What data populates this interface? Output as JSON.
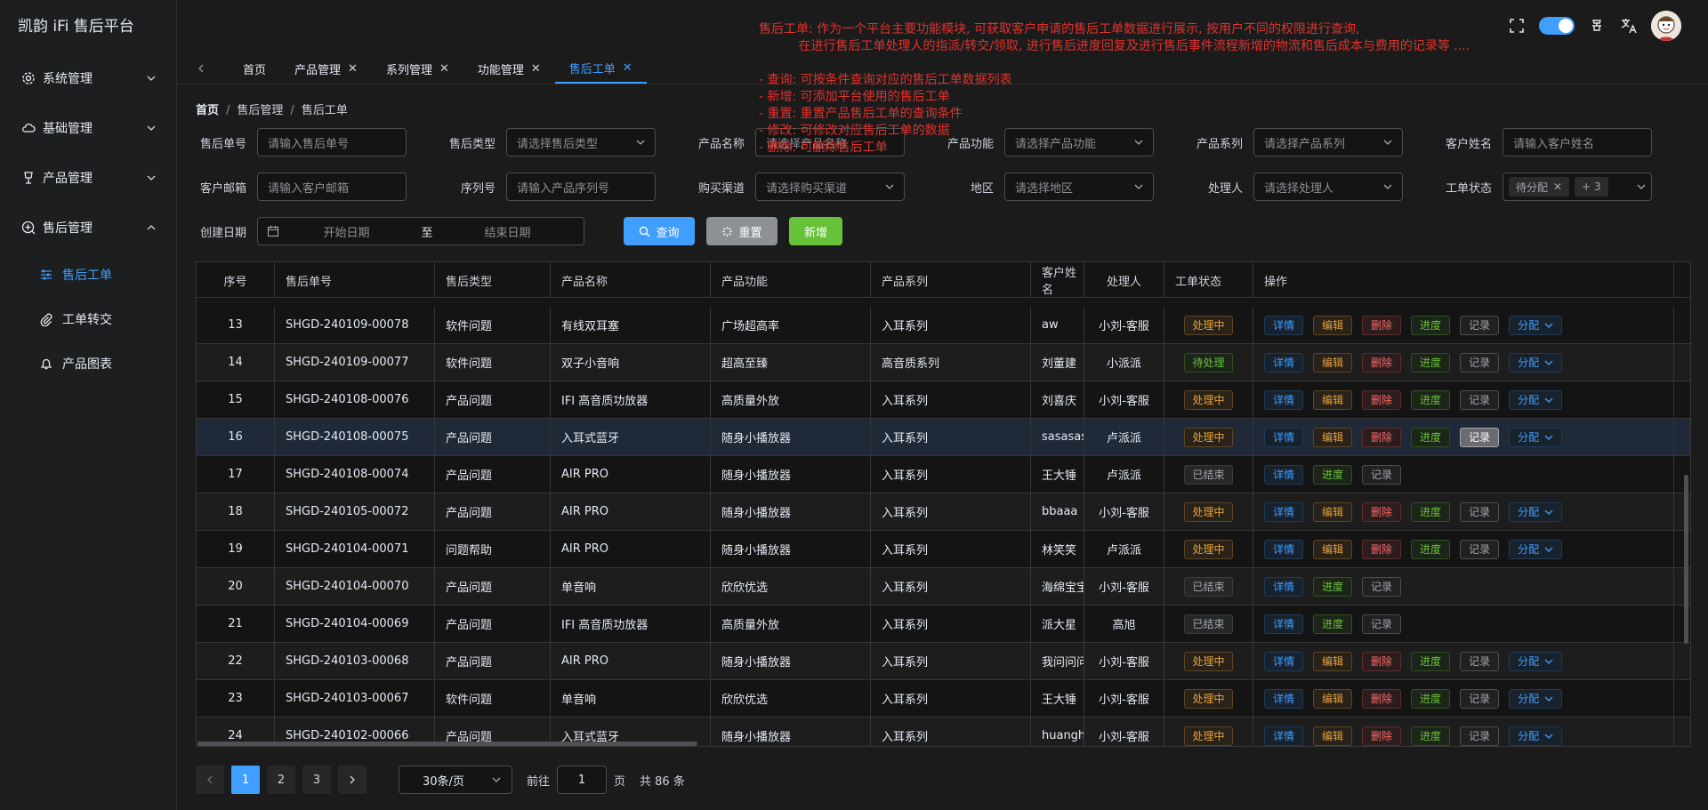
{
  "app": {
    "title": "凯韵 iFi 售后平台"
  },
  "sidebar": {
    "items": [
      {
        "label": "系统管理",
        "icon": "gear-icon"
      },
      {
        "label": "基础管理",
        "icon": "cloud-icon"
      },
      {
        "label": "产品管理",
        "icon": "lamp-icon"
      },
      {
        "label": "售后管理",
        "icon": "plus-circle-icon"
      }
    ],
    "subitems": [
      {
        "label": "售后工单",
        "icon": "sliders-icon",
        "active": true
      },
      {
        "label": "工单转交",
        "icon": "paperclip-icon"
      },
      {
        "label": "产品图表",
        "icon": "bell-icon"
      }
    ]
  },
  "tabs": [
    {
      "label": "首页",
      "closable": false
    },
    {
      "label": "产品管理",
      "closable": true
    },
    {
      "label": "系列管理",
      "closable": true
    },
    {
      "label": "功能管理",
      "closable": true
    },
    {
      "label": "售后工单",
      "closable": true,
      "active": true
    }
  ],
  "breadcrumb": [
    "首页",
    "售后管理",
    "售后工单"
  ],
  "notes": "售后工单: 作为一个平台主要功能模块, 可获取客户申请的售后工单数据进行展示, 按用户不同的权限进行查询,\n          在进行售后工单处理人的指派/转交/领取, 进行售后进度回复及进行售后事件流程新增的物流和售后成本与费用的记录等 ....\n\n- 查询: 可按条件查询对应的售后工单数据列表\n- 新增: 可添加平台使用的售后工单\n- 重置: 重置产品售后工单的查询条件\n- 修改: 可修改对应售后工单的数据\n- 删除: 可删除售后工单",
  "filters": {
    "row1": [
      {
        "label": "售后单号",
        "placeholder": "请输入售后单号",
        "type": "input"
      },
      {
        "label": "售后类型",
        "placeholder": "请选择售后类型",
        "type": "select"
      },
      {
        "label": "产品名称",
        "placeholder": "请选择产品名称",
        "type": "input"
      },
      {
        "label": "产品功能",
        "placeholder": "请选择产品功能",
        "type": "select"
      },
      {
        "label": "产品系列",
        "placeholder": "请选择产品系列",
        "type": "select"
      },
      {
        "label": "客户姓名",
        "placeholder": "请输入客户姓名",
        "type": "input"
      }
    ],
    "row2": [
      {
        "label": "客户邮箱",
        "placeholder": "请输入客户邮箱",
        "type": "input"
      },
      {
        "label": "序列号",
        "placeholder": "请输入产品序列号",
        "type": "input"
      },
      {
        "label": "购买渠道",
        "placeholder": "请选择购买渠道",
        "type": "select"
      },
      {
        "label": "地区",
        "placeholder": "请选择地区",
        "type": "select"
      },
      {
        "label": "处理人",
        "placeholder": "请选择处理人",
        "type": "select"
      }
    ],
    "status": {
      "label": "工单状态",
      "tag": "待分配",
      "more": "+ 3"
    },
    "date": {
      "label": "创建日期",
      "start": "开始日期",
      "to": "至",
      "end": "结束日期"
    }
  },
  "buttons": {
    "query": "查询",
    "reset": "重置",
    "add": "新增"
  },
  "table": {
    "headers": [
      "序号",
      "售后单号",
      "售后类型",
      "产品名称",
      "产品功能",
      "产品系列",
      "客户姓名",
      "处理人",
      "工单状态",
      "操作"
    ],
    "rows": [
      {
        "no": "13",
        "code": "SHGD-240109-00078",
        "type": "软件问题",
        "product": "有线双耳塞",
        "func": "广场超高率",
        "series": "入耳系列",
        "customer": "aw",
        "handler": "小刘-客服",
        "status": "处理中"
      },
      {
        "no": "14",
        "code": "SHGD-240109-00077",
        "type": "软件问题",
        "product": "双子小音响",
        "func": "超高至臻",
        "series": "高音质系列",
        "customer": "刘董建",
        "handler": "小派派",
        "status": "待处理"
      },
      {
        "no": "15",
        "code": "SHGD-240108-00076",
        "type": "产品问题",
        "product": "IFI 高音质功放器",
        "func": "高质量外放",
        "series": "入耳系列",
        "customer": "刘喜庆",
        "handler": "小刘-客服",
        "status": "处理中"
      },
      {
        "no": "16",
        "code": "SHGD-240108-00075",
        "type": "产品问题",
        "product": "入耳式蓝牙",
        "func": "随身小播放器",
        "series": "入耳系列",
        "customer": "sasasas",
        "handler": "卢派派",
        "status": "处理中"
      },
      {
        "no": "17",
        "code": "SHGD-240108-00074",
        "type": "产品问题",
        "product": "AIR PRO",
        "func": "随身小播放器",
        "series": "入耳系列",
        "customer": "王大锤",
        "handler": "卢派派",
        "status": "已结束"
      },
      {
        "no": "18",
        "code": "SHGD-240105-00072",
        "type": "产品问题",
        "product": "AIR PRO",
        "func": "随身小播放器",
        "series": "入耳系列",
        "customer": "bbaaa",
        "handler": "小刘-客服",
        "status": "处理中"
      },
      {
        "no": "19",
        "code": "SHGD-240104-00071",
        "type": "问题帮助",
        "product": "AIR PRO",
        "func": "随身小播放器",
        "series": "入耳系列",
        "customer": "林笑笑",
        "handler": "卢派派",
        "status": "处理中"
      },
      {
        "no": "20",
        "code": "SHGD-240104-00070",
        "type": "产品问题",
        "product": "单音响",
        "func": "欣欣优选",
        "series": "入耳系列",
        "customer": "海绵宝宝",
        "handler": "小刘-客服",
        "status": "已结束"
      },
      {
        "no": "21",
        "code": "SHGD-240104-00069",
        "type": "产品问题",
        "product": "IFI 高音质功放器",
        "func": "高质量外放",
        "series": "入耳系列",
        "customer": "派大星",
        "handler": "高旭",
        "status": "已结束"
      },
      {
        "no": "22",
        "code": "SHGD-240103-00068",
        "type": "产品问题",
        "product": "AIR PRO",
        "func": "随身小播放器",
        "series": "入耳系列",
        "customer": "我问问问",
        "handler": "小刘-客服",
        "status": "处理中"
      },
      {
        "no": "23",
        "code": "SHGD-240103-00067",
        "type": "软件问题",
        "product": "单音响",
        "func": "欣欣优选",
        "series": "入耳系列",
        "customer": "王大锤",
        "handler": "小刘-客服",
        "status": "处理中"
      },
      {
        "no": "24",
        "code": "SHGD-240102-00066",
        "type": "产品问题",
        "product": "入耳式蓝牙",
        "func": "随身小播放器",
        "series": "入耳系列",
        "customer": "huanghuang",
        "handler": "小刘-客服",
        "status": "处理中"
      }
    ],
    "ops": {
      "detail": "详情",
      "edit": "编辑",
      "delete": "删除",
      "progress": "进度",
      "log": "记录",
      "assign": "分配"
    }
  },
  "pagination": {
    "pages": [
      "1",
      "2",
      "3"
    ],
    "current": "1",
    "page_size": "30条/页",
    "goto_label": "前往",
    "goto_value": "1",
    "page_unit": "页",
    "total": "共 86 条"
  }
}
